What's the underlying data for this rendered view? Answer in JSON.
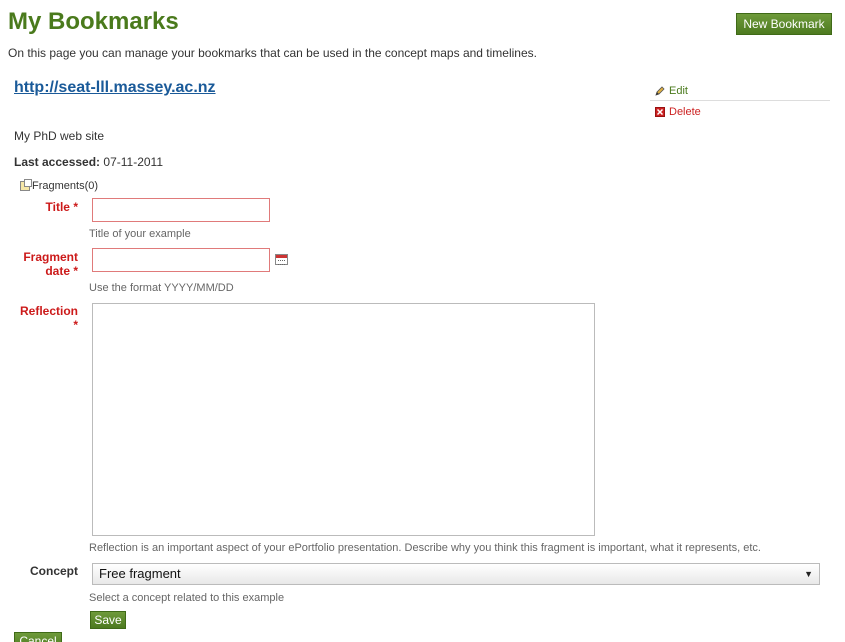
{
  "header": {
    "title": "My Bookmarks",
    "new_bookmark_label": "New Bookmark",
    "intro": "On this page you can manage your bookmarks that can be used in the concept maps and timelines."
  },
  "bookmark": {
    "url": "http://seat-lll.massey.ac.nz",
    "description": "My PhD web site",
    "last_accessed_label": "Last accessed:",
    "last_accessed_value": "07-11-2011",
    "actions": {
      "edit_label": "Edit",
      "delete_label": "Delete"
    },
    "fragments_label": "Fragments(0)"
  },
  "form": {
    "title": {
      "label": "Title *",
      "value": "",
      "help": "Title of your example"
    },
    "fragment_date": {
      "label_line1": "Fragment",
      "label_line2": "date *",
      "value": "",
      "help": "Use the format YYYY/MM/DD"
    },
    "reflection": {
      "label_line1": "Reflection",
      "label_line2": "*",
      "value": "",
      "help": "Reflection is an important aspect of your ePortfolio presentation. Describe why you think this fragment is important, what it represents, etc."
    },
    "concept": {
      "label": "Concept",
      "selected": "Free fragment",
      "help": "Select a concept related to this example"
    },
    "save_label": "Save",
    "cancel_label": "Cancel"
  },
  "colors": {
    "accent_green": "#4a7a1c",
    "required_red": "#cc1a1a",
    "link_blue": "#1a5a99"
  }
}
